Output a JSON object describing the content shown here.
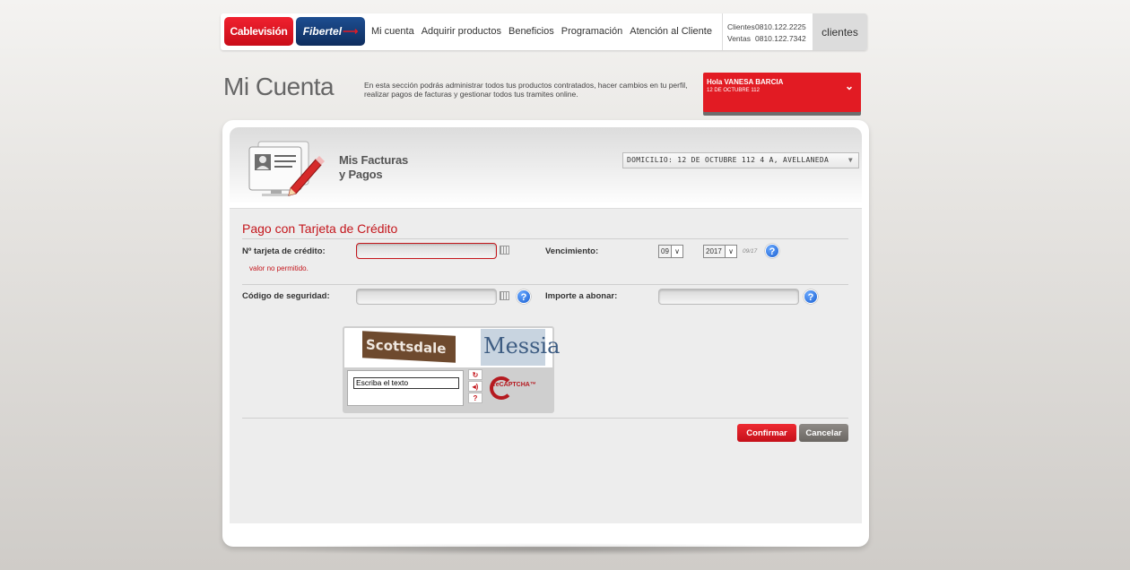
{
  "header": {
    "logo_cablevision": "Cablevisión",
    "logo_fibertel": "Fibertel",
    "nav": [
      "Mi cuenta",
      "Adquirir productos",
      "Beneficios",
      "Programación",
      "Atención al Cliente"
    ],
    "phones": {
      "clientes_label": "Clientes",
      "clientes_number": "0810.122.2225",
      "ventas_label": "Ventas",
      "ventas_number": "0810.122.7342"
    },
    "clientes_button": "clientes"
  },
  "page": {
    "title": "Mi Cuenta",
    "description": "En esta sección podrás administrar todos tus productos contratados, hacer cambios en tu perfil, realizar pagos de facturas y gestionar todos tus tramites online."
  },
  "user": {
    "greeting": "Hola VANESA BARCIA",
    "address": "12 DE OCTUBRE 112",
    "accent_color": "#e21b23"
  },
  "section": {
    "title_line1": "Mis Facturas",
    "title_line2": "y Pagos",
    "domicilio": "DOMICILIO: 12 DE OCTUBRE 112 4 A, AVELLANEDA"
  },
  "form": {
    "title": "Pago con Tarjeta de Crédito",
    "card_number_label": "Nº tarjeta de crédito:",
    "card_number_value": "",
    "card_number_error": "valor no permitido.",
    "expiry_label": "Vencimiento:",
    "expiry_month": "09",
    "expiry_year": "2017",
    "expiry_note": "09/17",
    "security_code_label": "Código de seguridad:",
    "amount_label": "Importe a abonar:",
    "captcha": {
      "word1": "Scottsdale",
      "word2": "Messia",
      "input_value": "Escriba el texto",
      "logo_text": "reCAPTCHA™"
    },
    "confirm_button": "Confirmar",
    "cancel_button": "Cancelar"
  }
}
